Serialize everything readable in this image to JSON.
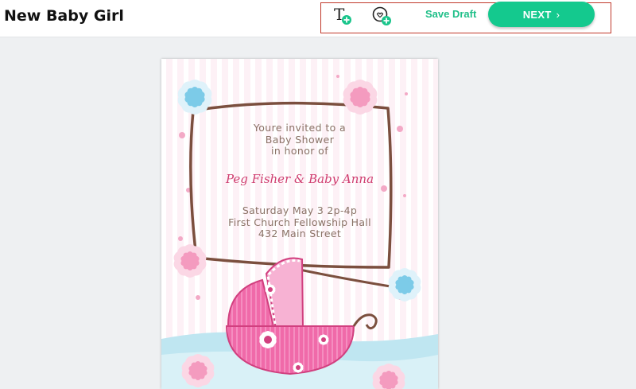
{
  "header": {
    "title": "New Baby Girl",
    "save_draft_label": "Save Draft",
    "next_label": "NEXT",
    "next_chevron": "›",
    "tools": [
      {
        "icon": "add-text-icon"
      },
      {
        "icon": "add-sticker-icon"
      }
    ]
  },
  "colors": {
    "accent": "#14c98e",
    "save_draft": "#1fbf88",
    "highlight_border": "#c0392b"
  },
  "invitation": {
    "invited_line1": "Youre invited to a",
    "invited_line2": "Baby Shower",
    "invited_line3": "in honor of",
    "honorees": "Peg Fisher & Baby Anna",
    "date_time": "Saturday  May 3  2p-4p",
    "venue": "First Church Fellowship Hall",
    "address": "432 Main Street"
  }
}
